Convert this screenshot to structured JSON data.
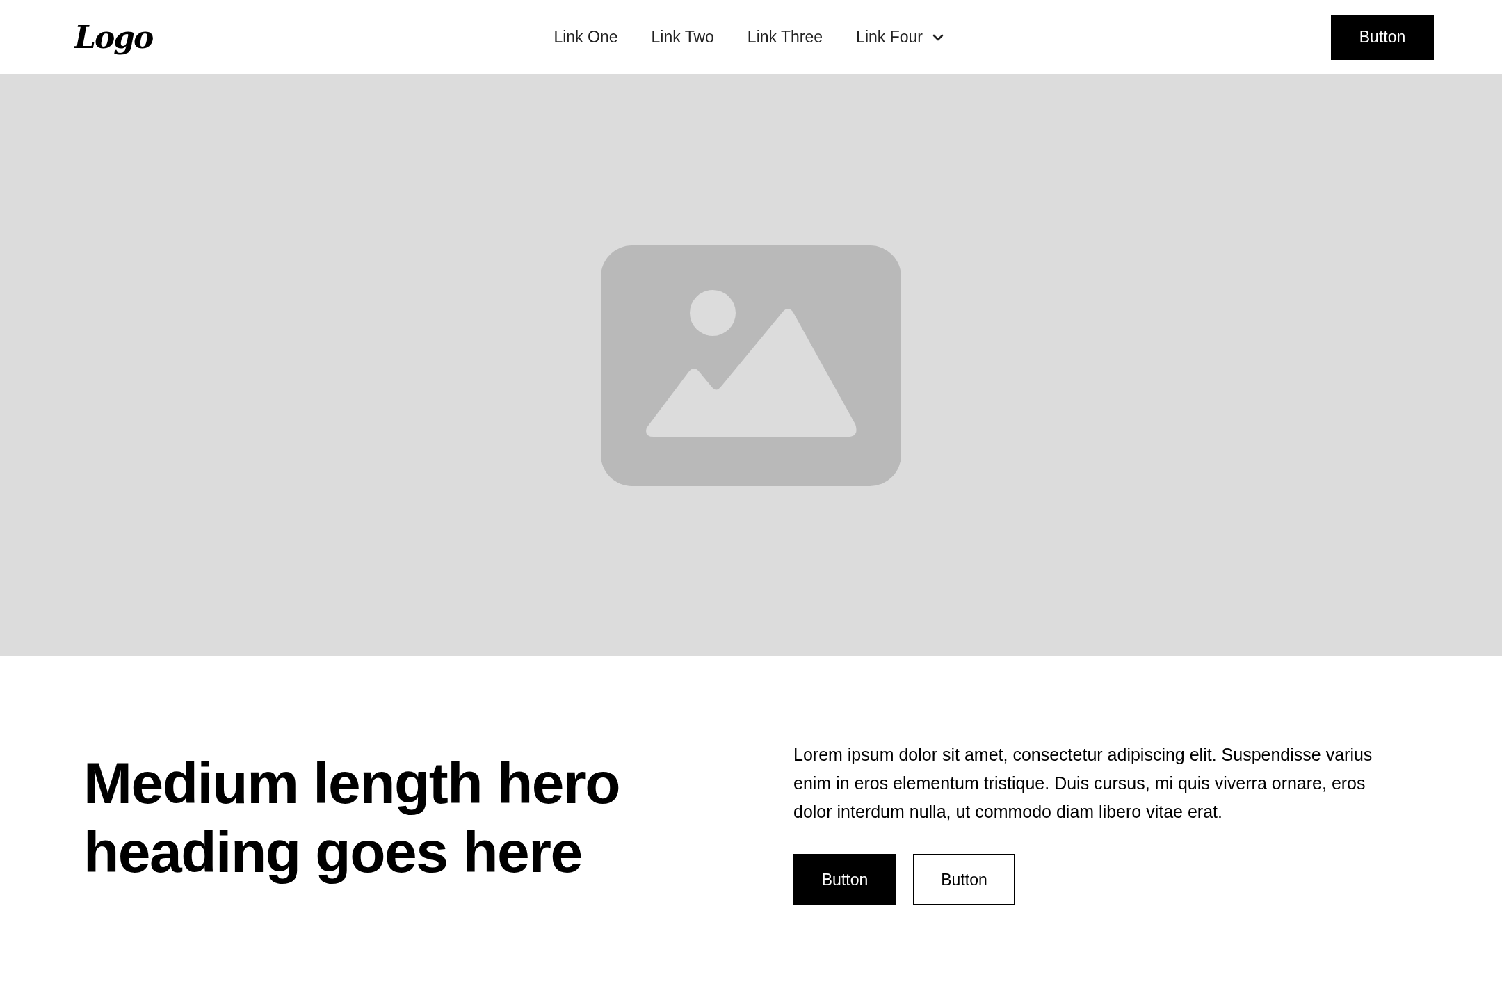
{
  "navbar": {
    "logo": "Logo",
    "links": [
      {
        "label": "Link One",
        "kind": "link"
      },
      {
        "label": "Link Two",
        "kind": "link"
      },
      {
        "label": "Link Three",
        "kind": "link"
      },
      {
        "label": "Link Four",
        "kind": "dropdown"
      }
    ],
    "button": "Button"
  },
  "hero": {
    "image": {
      "kind": "placeholder"
    },
    "heading": "Medium length hero heading goes here",
    "text": "Lorem ipsum dolor sit amet, consectetur adipiscing elit. Suspendisse varius enim in eros elementum tristique. Duis cursus, mi quis viverra ornare, eros dolor interdum nulla, ut commodo diam libero vitae erat.",
    "buttons": [
      {
        "label": "Button",
        "kind": "primary"
      },
      {
        "label": "Button",
        "kind": "outline"
      }
    ]
  }
}
